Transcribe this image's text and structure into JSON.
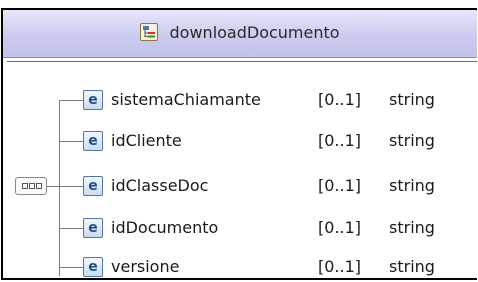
{
  "complex_type": {
    "name": "downloadDocumento",
    "icon": "complex-type-icon"
  },
  "compositor": {
    "kind": "sequence",
    "icon": "sequence-compositor-icon"
  },
  "element_icon_letter": "e",
  "elements": [
    {
      "name": "sistemaChiamante",
      "cardinality": "[0..1]",
      "type": "string"
    },
    {
      "name": "idCliente",
      "cardinality": "[0..1]",
      "type": "string"
    },
    {
      "name": "idClasseDoc",
      "cardinality": "[0..1]",
      "type": "string"
    },
    {
      "name": "idDocumento",
      "cardinality": "[0..1]",
      "type": "string"
    },
    {
      "name": "versione",
      "cardinality": "[0..1]",
      "type": "string"
    }
  ],
  "colors": {
    "header_top": "#e6e6fb",
    "header_bottom": "#c2c2ea",
    "element_icon_border": "#4f77a8",
    "element_icon_text": "#1f4e86"
  }
}
